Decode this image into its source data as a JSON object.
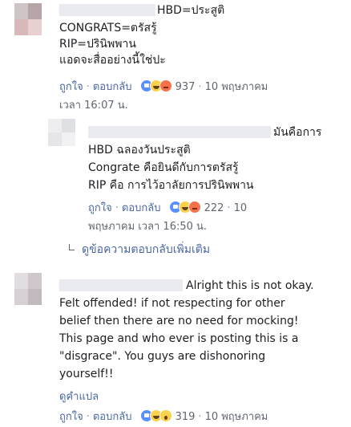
{
  "comments": [
    {
      "id": "c1",
      "lines": [
        "HBD=ประสูติ",
        "CONGRATS=ตรัสรู้",
        "RIP=ปรินิพพาน",
        "แอดจะสื่ออย่างนี้ใช่ปะ"
      ],
      "like_label": "ถูกใจ",
      "reply_label": "ตอบกลับ",
      "reaction_icons": [
        "like-icon",
        "haha-icon",
        "angry-icon"
      ],
      "reaction_count": "937",
      "date": "10 พฤษภาคม",
      "time": "เวลา 16:07 น."
    },
    {
      "id": "c2",
      "lines": [
        "มันคือการ",
        "HBD ฉลองวันประสูติ",
        "Congrate คือยินดีกับการตรัสรู้",
        "RIP คือ การไว้อาลัยการปรินิพพาน"
      ],
      "like_label": "ถูกใจ",
      "reply_label": "ตอบกลับ",
      "reaction_icons": [
        "like-icon",
        "haha-icon",
        "angry-icon"
      ],
      "reaction_count": "222",
      "date": "10",
      "time": "พฤษภาคม เวลา 16:50 น."
    },
    {
      "id": "c3",
      "lines": [
        "Alright this is not okay.",
        "Felt offended! if not respecting for other",
        "belief then there are no need for mocking!",
        "This page and who ever is posting this is a",
        "\"disgrace\". You guys are dishonoring",
        "yourself!!"
      ],
      "translate_label": "ดูคำแปล",
      "like_label": "ถูกใจ",
      "reply_label": "ตอบกลับ",
      "reaction_icons": [
        "like-icon",
        "haha-icon",
        "wow-icon"
      ],
      "reaction_count": "319",
      "date": "10 พฤษภาคม"
    }
  ],
  "more_replies_label": "ดูข้อความตอบกลับเพิ่มเติม",
  "separator": "·"
}
